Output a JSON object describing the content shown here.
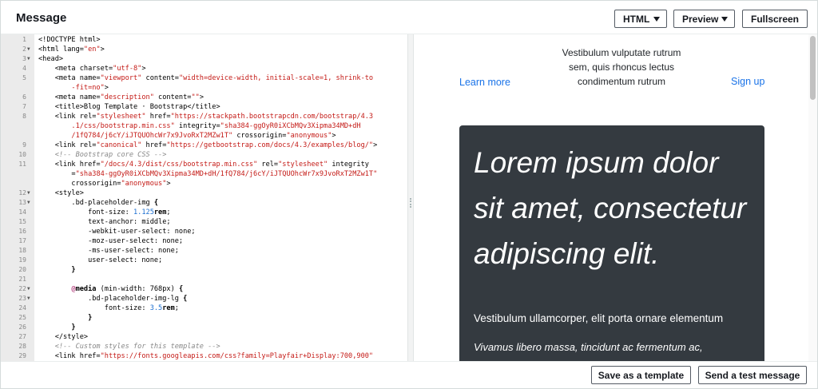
{
  "header": {
    "title": "Message",
    "format_select": "HTML",
    "view_select": "Preview",
    "fullscreen_label": "Fullscreen"
  },
  "editor": {
    "lines": [
      {
        "n": "1",
        "fold": false,
        "segs": [
          {
            "c": "t-tag",
            "t": "<!DOCTYPE html>"
          }
        ]
      },
      {
        "n": "2",
        "fold": true,
        "segs": [
          {
            "c": "t-tag",
            "t": "<html lang="
          },
          {
            "c": "t-str",
            "t": "\"en\""
          },
          {
            "c": "t-tag",
            "t": ">"
          }
        ]
      },
      {
        "n": "3",
        "fold": true,
        "segs": [
          {
            "c": "t-tag",
            "t": "<head>"
          }
        ]
      },
      {
        "n": "4",
        "fold": false,
        "segs": [
          {
            "c": "t-tag",
            "t": "    <meta charset="
          },
          {
            "c": "t-str",
            "t": "\"utf-8\""
          },
          {
            "c": "t-tag",
            "t": ">"
          }
        ]
      },
      {
        "n": "5",
        "fold": false,
        "segs": [
          {
            "c": "t-tag",
            "t": "    <meta name="
          },
          {
            "c": "t-str",
            "t": "\"viewport\""
          },
          {
            "c": "t-tag",
            "t": " content="
          },
          {
            "c": "t-str",
            "t": "\"width=device-width, initial-scale=1, shrink-to"
          }
        ]
      },
      {
        "n": "",
        "fold": false,
        "segs": [
          {
            "c": "t-str",
            "t": "        -fit=no\""
          },
          {
            "c": "t-tag",
            "t": ">"
          }
        ]
      },
      {
        "n": "6",
        "fold": false,
        "segs": [
          {
            "c": "t-tag",
            "t": "    <meta name="
          },
          {
            "c": "t-str",
            "t": "\"description\""
          },
          {
            "c": "t-tag",
            "t": " content="
          },
          {
            "c": "t-str",
            "t": "\"\""
          },
          {
            "c": "t-tag",
            "t": ">"
          }
        ]
      },
      {
        "n": "7",
        "fold": false,
        "segs": [
          {
            "c": "t-tag",
            "t": "    <title>Blog Template · Bootstrap</title>"
          }
        ]
      },
      {
        "n": "8",
        "fold": false,
        "segs": [
          {
            "c": "t-tag",
            "t": "    <link rel="
          },
          {
            "c": "t-str",
            "t": "\"stylesheet\""
          },
          {
            "c": "t-tag",
            "t": " href="
          },
          {
            "c": "t-str",
            "t": "\"https://stackpath.bootstrapcdn.com/bootstrap/4.3"
          }
        ]
      },
      {
        "n": "",
        "fold": false,
        "segs": [
          {
            "c": "t-str",
            "t": "        .1/css/bootstrap.min.css\""
          },
          {
            "c": "t-tag",
            "t": " integrity="
          },
          {
            "c": "t-str",
            "t": "\"sha384-ggOyR0iXCbMQv3Xipma34MD+dH"
          }
        ]
      },
      {
        "n": "",
        "fold": false,
        "segs": [
          {
            "c": "t-str",
            "t": "        /1fQ784/j6cY/iJTQUOhcWr7x9JvoRxT2MZw1T\""
          },
          {
            "c": "t-tag",
            "t": " crossorigin="
          },
          {
            "c": "t-str",
            "t": "\"anonymous\""
          },
          {
            "c": "t-tag",
            "t": ">"
          }
        ]
      },
      {
        "n": "9",
        "fold": false,
        "segs": [
          {
            "c": "t-tag",
            "t": "    <link rel="
          },
          {
            "c": "t-str",
            "t": "\"canonical\""
          },
          {
            "c": "t-tag",
            "t": " href="
          },
          {
            "c": "t-str",
            "t": "\"https://getbootstrap.com/docs/4.3/examples/blog/\""
          },
          {
            "c": "t-tag",
            "t": ">"
          }
        ]
      },
      {
        "n": "10",
        "fold": false,
        "segs": [
          {
            "c": "t-com",
            "t": "    <!-- Bootstrap core CSS -->"
          }
        ]
      },
      {
        "n": "11",
        "fold": false,
        "segs": [
          {
            "c": "t-tag",
            "t": "    <link href="
          },
          {
            "c": "t-str",
            "t": "\"/docs/4.3/dist/css/bootstrap.min.css\""
          },
          {
            "c": "t-tag",
            "t": " rel="
          },
          {
            "c": "t-str",
            "t": "\"stylesheet\""
          },
          {
            "c": "t-tag",
            "t": " integrity"
          }
        ]
      },
      {
        "n": "",
        "fold": false,
        "segs": [
          {
            "c": "t-tag",
            "t": "        ="
          },
          {
            "c": "t-str",
            "t": "\"sha384-ggOyR0iXCbMQv3Xipma34MD+dH/1fQ784/j6cY/iJTQUOhcWr7x9JvoRxT2MZw1T\""
          }
        ]
      },
      {
        "n": "",
        "fold": false,
        "segs": [
          {
            "c": "t-tag",
            "t": "        crossorigin="
          },
          {
            "c": "t-str",
            "t": "\"anonymous\""
          },
          {
            "c": "t-tag",
            "t": ">"
          }
        ]
      },
      {
        "n": "12",
        "fold": true,
        "segs": [
          {
            "c": "t-tag",
            "t": "    <style>"
          }
        ]
      },
      {
        "n": "13",
        "fold": true,
        "segs": [
          {
            "c": "t-tag",
            "t": "        .bd-placeholder-img "
          },
          {
            "c": "t-kw",
            "t": "{"
          }
        ]
      },
      {
        "n": "14",
        "fold": false,
        "segs": [
          {
            "c": "t-tag",
            "t": "            font-size: "
          },
          {
            "c": "t-num",
            "t": "1.125"
          },
          {
            "c": "t-kw",
            "t": "rem"
          },
          {
            "c": "t-tag",
            "t": ";"
          }
        ]
      },
      {
        "n": "15",
        "fold": false,
        "segs": [
          {
            "c": "t-tag",
            "t": "            text-anchor: middle;"
          }
        ]
      },
      {
        "n": "16",
        "fold": false,
        "segs": [
          {
            "c": "t-tag",
            "t": "            -webkit-user-select: none;"
          }
        ]
      },
      {
        "n": "17",
        "fold": false,
        "segs": [
          {
            "c": "t-tag",
            "t": "            -moz-user-select: none;"
          }
        ]
      },
      {
        "n": "18",
        "fold": false,
        "segs": [
          {
            "c": "t-tag",
            "t": "            -ms-user-select: none;"
          }
        ]
      },
      {
        "n": "19",
        "fold": false,
        "segs": [
          {
            "c": "t-tag",
            "t": "            user-select: none;"
          }
        ]
      },
      {
        "n": "20",
        "fold": false,
        "segs": [
          {
            "c": "t-kw",
            "t": "        }"
          }
        ]
      },
      {
        "n": "21",
        "fold": false,
        "segs": [
          {
            "c": "t-tag",
            "t": ""
          }
        ]
      },
      {
        "n": "22",
        "fold": true,
        "segs": [
          {
            "c": "t-at",
            "t": "        @"
          },
          {
            "c": "t-kw",
            "t": "media"
          },
          {
            "c": "t-tag",
            "t": " (min-width: 768px) "
          },
          {
            "c": "t-kw",
            "t": "{"
          }
        ]
      },
      {
        "n": "23",
        "fold": true,
        "segs": [
          {
            "c": "t-tag",
            "t": "            .bd-placeholder-img-lg "
          },
          {
            "c": "t-kw",
            "t": "{"
          }
        ]
      },
      {
        "n": "24",
        "fold": false,
        "segs": [
          {
            "c": "t-tag",
            "t": "                font-size: "
          },
          {
            "c": "t-num",
            "t": "3.5"
          },
          {
            "c": "t-kw",
            "t": "rem"
          },
          {
            "c": "t-tag",
            "t": ";"
          }
        ]
      },
      {
        "n": "25",
        "fold": false,
        "segs": [
          {
            "c": "t-kw",
            "t": "            }"
          }
        ]
      },
      {
        "n": "26",
        "fold": false,
        "segs": [
          {
            "c": "t-kw",
            "t": "        }"
          }
        ]
      },
      {
        "n": "27",
        "fold": false,
        "segs": [
          {
            "c": "t-tag",
            "t": "    </style>"
          }
        ]
      },
      {
        "n": "28",
        "fold": false,
        "segs": [
          {
            "c": "t-com",
            "t": "    <!-- Custom styles for this template -->"
          }
        ]
      },
      {
        "n": "29",
        "fold": false,
        "segs": [
          {
            "c": "t-tag",
            "t": "    <link href="
          },
          {
            "c": "t-str",
            "t": "\"https://fonts.googleapis.com/css?family=Playfair+Display:700,900\""
          }
        ]
      }
    ]
  },
  "preview": {
    "left_link": "Learn more",
    "brand_text": "Vestibulum vulputate rutrum sem, quis rhoncus lectus condimentum rutrum",
    "right_link": "Sign up",
    "heading": "Lorem ipsum dolor sit amet, consectetur adipiscing elit.",
    "lead": "Vestibulum ullamcorper, elit porta ornare elementum",
    "sub": "Vivamus libero massa, tincidunt ac fermentum ac,"
  },
  "footer": {
    "save_template_label": "Save as a template",
    "send_test_label": "Send a test message"
  },
  "colors": {
    "jumbotron_bg": "#343a40",
    "link": "#1a73e8"
  }
}
